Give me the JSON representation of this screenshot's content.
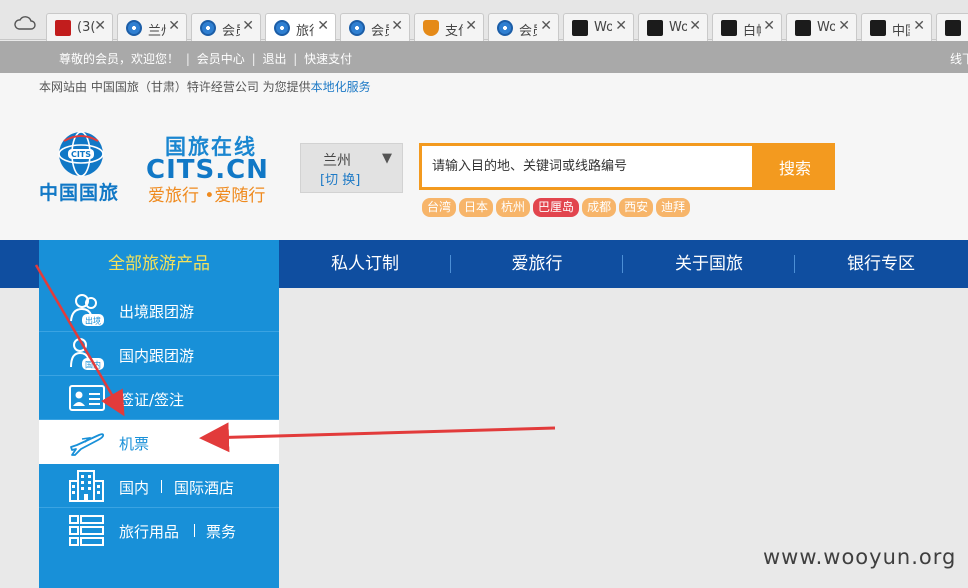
{
  "browser": {
    "tabs": [
      {
        "text": "(3(",
        "icon": "brand-icon"
      },
      {
        "text": "兰州",
        "icon": "globe-icon"
      },
      {
        "text": "会员",
        "icon": "globe-icon"
      },
      {
        "text": "旅行",
        "icon": "globe-icon",
        "active": true
      },
      {
        "text": "会员",
        "icon": "globe-icon"
      },
      {
        "text": "支付",
        "icon": "shield-icon"
      },
      {
        "text": "会员",
        "icon": "globe-icon"
      },
      {
        "text": "Wo",
        "icon": "wooyun-icon"
      },
      {
        "text": "Wo",
        "icon": "wooyun-icon"
      },
      {
        "text": "白帽",
        "icon": "wooyun-icon"
      },
      {
        "text": "Wo",
        "icon": "wooyun-icon"
      },
      {
        "text": "中国",
        "icon": "wooyun-icon"
      },
      {
        "text": "",
        "icon": "wooyun-icon"
      }
    ],
    "close_glyph": "✕"
  },
  "member_bar": {
    "welcome": "尊敬的会员，欢迎您！",
    "links": [
      "会员中心",
      "退出",
      "快速支付"
    ],
    "separator": "|",
    "right_text": "线下"
  },
  "header": {
    "notice_prefix": "本网站由 中国国旅（甘肃）特许经营公司 为您提供",
    "notice_link": "本地化服务",
    "logo_cn": "中国国旅",
    "logo_badge": "CITS",
    "brand_title": "国旅在线",
    "brand_domain": "CITS.CN",
    "brand_slogan": "爱旅行 •爱随行",
    "city": {
      "name": "兰州",
      "switch": "[切 换]",
      "caret": "▼"
    },
    "search": {
      "placeholder": "请输入目的地、关键词或线路编号",
      "button": "搜索"
    },
    "hot_tags": [
      "台湾",
      "日本",
      "杭州",
      "巴厘岛",
      "成都",
      "西安",
      "迪拜"
    ]
  },
  "nav": {
    "all_products": "全部旅游产品",
    "items": [
      "私人订制",
      "爱旅行",
      "关于国旅",
      "银行专区"
    ]
  },
  "side_menu": [
    {
      "label": "出境跟团游",
      "icon": "outbound-group-icon",
      "badge": "出境"
    },
    {
      "label": "国内跟团游",
      "icon": "domestic-group-icon",
      "badge": "国内"
    },
    {
      "label": "签证/签注",
      "icon": "visa-card-icon"
    },
    {
      "label": "机票",
      "icon": "airplane-icon",
      "active": true
    },
    {
      "label_a": "国内",
      "label_b": "国际酒店",
      "icon": "hotel-building-icon"
    },
    {
      "label_a": "旅行用品",
      "label_b": "票务",
      "icon": "list-grid-icon"
    }
  ],
  "watermark": "www.wooyun.org",
  "colors": {
    "nav_blue": "#0f4ea0",
    "menu_blue": "#1890d8",
    "search_orange": "#f39a1f",
    "tag_orange": "#f7b56a",
    "tag_red": "#e2454e",
    "annotation_red": "#e23b3b"
  }
}
